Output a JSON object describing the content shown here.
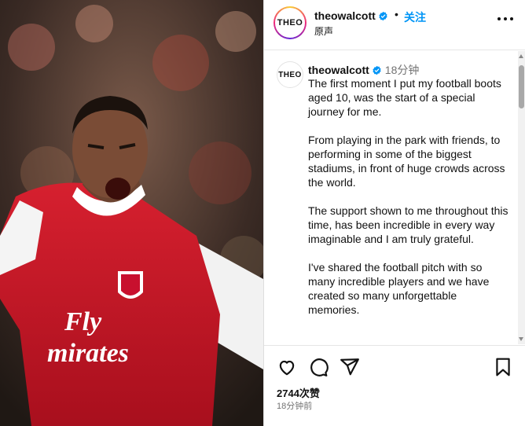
{
  "media": {
    "shirt_sponsor_line1": "Fly",
    "shirt_sponsor_line2": "mirates",
    "accent_red": "#c8102e"
  },
  "header": {
    "avatar_text": "THEO",
    "username": "theowalcott",
    "separator": "•",
    "follow_label": "关注",
    "subtitle": "原声"
  },
  "caption": {
    "avatar_text": "THEO",
    "username": "theowalcott",
    "time": "18分钟",
    "paragraphs": [
      "The first moment I put my football boots aged 10, was the start of a special journey for me.",
      "From playing in the park with friends, to performing in some of the biggest stadiums, in front of huge crowds across the world.",
      "The support shown to me throughout this time, has been incredible in every way imaginable and I am truly grateful.",
      "I've shared the football pitch with so many incredible players and we have created so many unforgettable memories."
    ]
  },
  "footer": {
    "likes": "2744次赞",
    "posted": "18分钟前",
    "icons": [
      "heart-icon",
      "comment-icon",
      "share-icon",
      "bookmark-icon"
    ]
  },
  "colors": {
    "link_blue": "#0095f6",
    "verified_blue": "#0095f6",
    "muted": "#737373"
  }
}
